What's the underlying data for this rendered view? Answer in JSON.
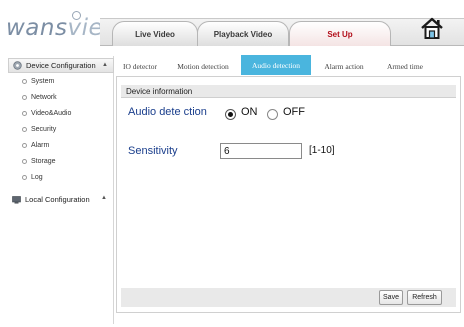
{
  "brand": {
    "logo_part1": "wans",
    "logo_part2": "view"
  },
  "main_tabs": {
    "live": "Live Video",
    "playback": "Playback Video",
    "setup": "Set Up"
  },
  "sidebar": {
    "device_configuration": "Device Configuration",
    "items": [
      "System",
      "Network",
      "Video&Audio",
      "Security",
      "Alarm",
      "Storage",
      "Log"
    ],
    "local_configuration": "Local Configuration"
  },
  "sub_tabs": {
    "io_detector": "IO detector",
    "motion_detection": "Motion detection",
    "audio_detection": "Audio detection",
    "alarm_action": "Alarm action",
    "armed_time": "Armed time"
  },
  "content": {
    "section_title": "Device information",
    "audio_detection_label": "Audio dete ction",
    "option_on": "ON",
    "option_off": "OFF",
    "selected": "ON",
    "sensitivity_label": "Sensitivity",
    "sensitivity_value": "6",
    "sensitivity_range": "[1-10]"
  },
  "buttons": {
    "save": "Save",
    "refresh": "Refresh"
  },
  "colors": {
    "active_subtab": "#4ab5de",
    "setup_tab_text": "#b20e1a",
    "label_blue": "#1a3e8c"
  }
}
